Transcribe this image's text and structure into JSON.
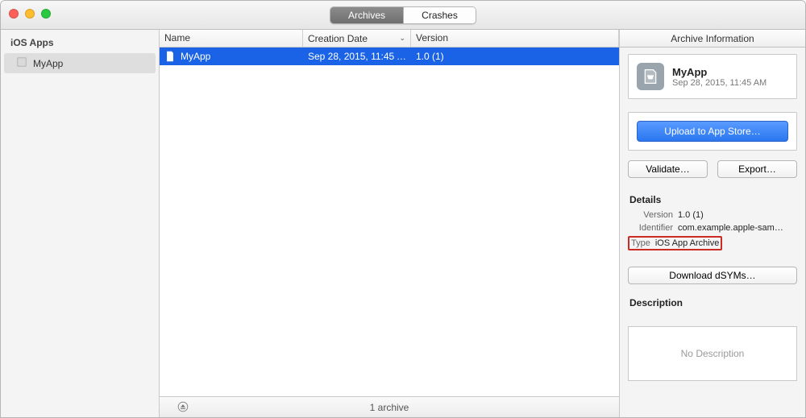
{
  "tabs": {
    "archives": "Archives",
    "crashes": "Crashes"
  },
  "sidebar": {
    "header": "iOS Apps",
    "items": [
      {
        "label": "MyApp"
      }
    ]
  },
  "columns": {
    "name": "Name",
    "date": "Creation Date",
    "version": "Version"
  },
  "rows": [
    {
      "name": "MyApp",
      "date": "Sep 28, 2015, 11:45 AM",
      "version": "1.0 (1)"
    }
  ],
  "footer": {
    "count": "1 archive"
  },
  "inspector": {
    "title": "Archive Information",
    "app": {
      "name": "MyApp",
      "date": "Sep 28, 2015, 11:45 AM"
    },
    "upload_label": "Upload to App Store…",
    "validate_label": "Validate…",
    "export_label": "Export…",
    "details_title": "Details",
    "version_label": "Version",
    "version_value": "1.0 (1)",
    "identifier_label": "Identifier",
    "identifier_value": "com.example.apple-sam…",
    "type_label": "Type",
    "type_value": "iOS App Archive",
    "download_dsyms_label": "Download dSYMs…",
    "description_title": "Description",
    "description_placeholder": "No Description"
  }
}
